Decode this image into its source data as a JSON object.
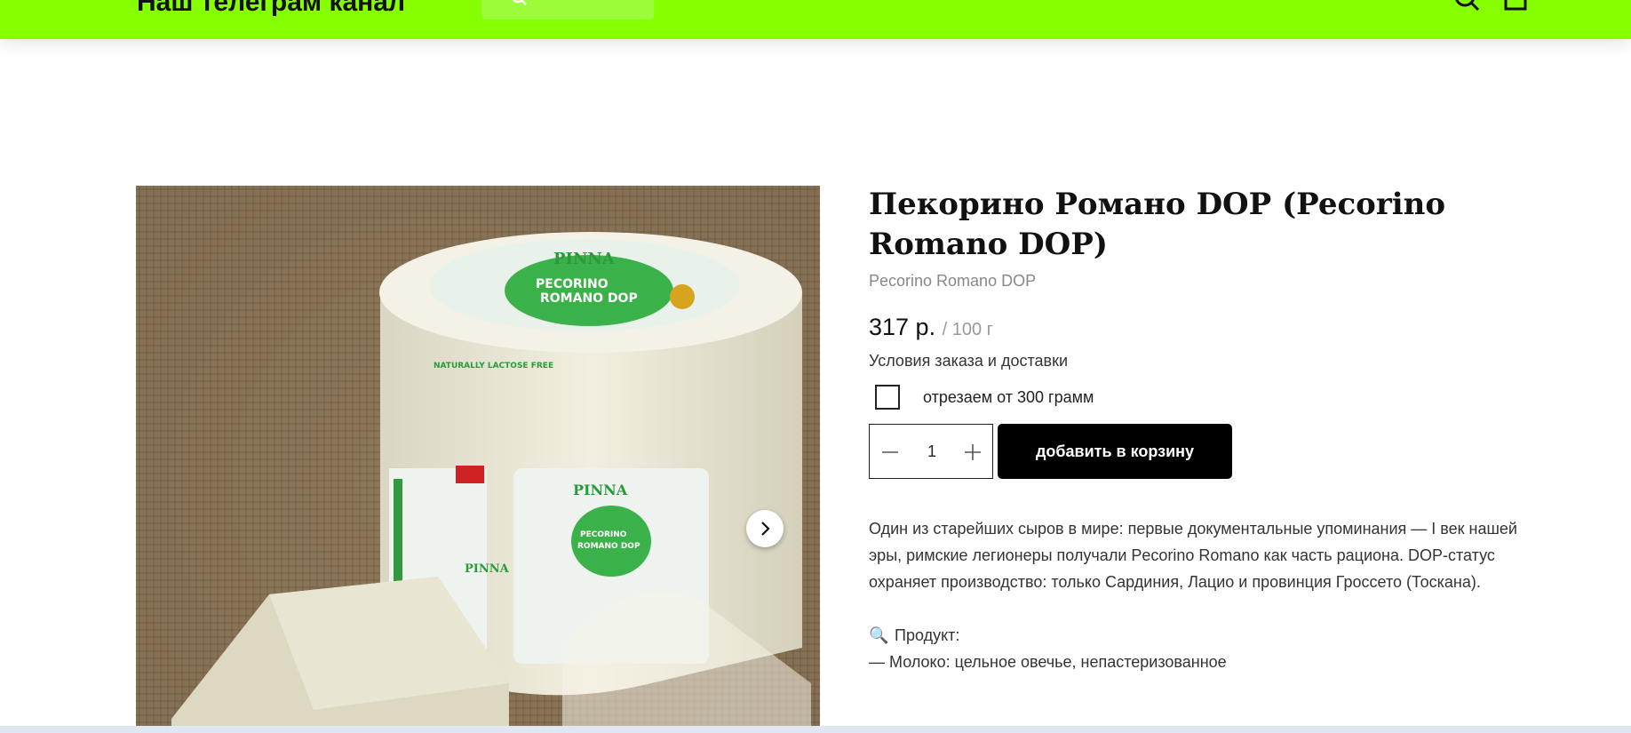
{
  "header": {
    "brand": "Наш телеграм канал",
    "bg_color": "#86ff00",
    "search_icon": "search-icon",
    "cart_icon": "cart-icon"
  },
  "gallery": {
    "next_icon": "chevron-right-icon"
  },
  "product": {
    "title": "Пекорино Романо DOP (Pecorino Romano DOP)",
    "subtitle": "Pecorino Romano DOP",
    "price": "317 р.",
    "price_unit": "/ 100 г",
    "delivery_link": "Условия заказа и доставки",
    "option_label": "отрезаем от 300 грамм",
    "quantity": "1",
    "add_to_cart": "добавить в корзину",
    "description": "Один из старейших сыров в мире: первые документальные упоминания — I век нашей эры, римские легионеры получали Pecorino Romano как часть рациона. DOP-статус охраняет производство: только Сардиния, Лацио и провинция Гроссето (Тоскана).",
    "section_emoji": "🔍",
    "section_title": "Продукт:",
    "section_line": "— Молоко: цельное овечье, непастеризованное"
  }
}
